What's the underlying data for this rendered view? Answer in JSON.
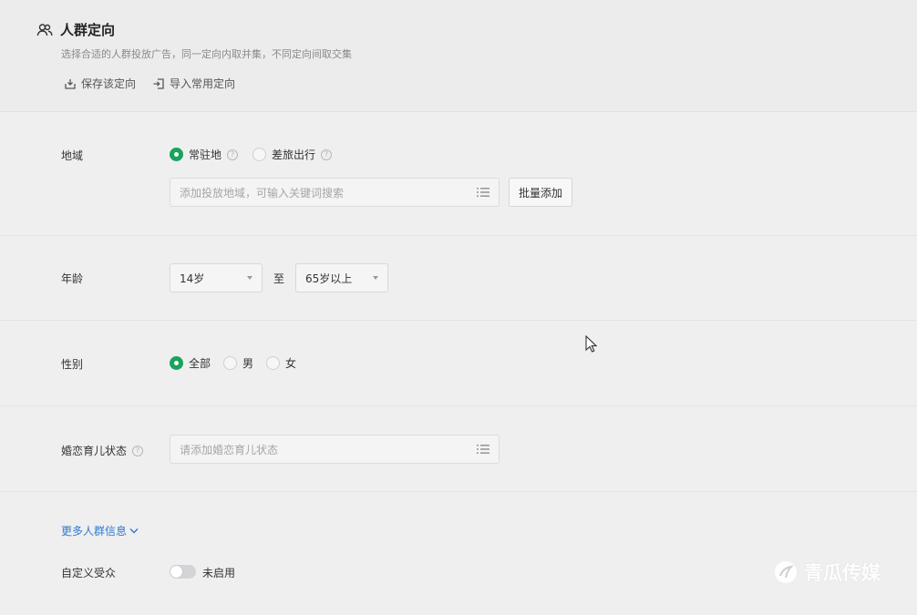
{
  "header": {
    "title": "人群定向",
    "description": "选择合适的人群投放广告，同一定向内取并集，不同定向间取交集",
    "actions": [
      {
        "label": "保存该定向",
        "icon": "save-icon"
      },
      {
        "label": "导入常用定向",
        "icon": "import-icon"
      }
    ]
  },
  "region": {
    "label": "地域",
    "options": [
      {
        "label": "常驻地",
        "checked": true
      },
      {
        "label": "差旅出行",
        "checked": false
      }
    ],
    "input_placeholder": "添加投放地域，可输入关键词搜索",
    "batch_button": "批量添加"
  },
  "age": {
    "label": "年龄",
    "from": "14岁",
    "to_label": "至",
    "to": "65岁以上"
  },
  "gender": {
    "label": "性别",
    "options": [
      {
        "label": "全部",
        "checked": true
      },
      {
        "label": "男",
        "checked": false
      },
      {
        "label": "女",
        "checked": false
      }
    ]
  },
  "marital": {
    "label": "婚恋育儿状态",
    "input_placeholder": "请添加婚恋育儿状态"
  },
  "more": {
    "label": "更多人群信息"
  },
  "custom_audience": {
    "label": "自定义受众",
    "switch_state": "未启用"
  },
  "watermark": {
    "text": "青瓜传媒"
  },
  "colors": {
    "accent_green": "#1aa35c",
    "link_blue": "#2f7ad1"
  }
}
